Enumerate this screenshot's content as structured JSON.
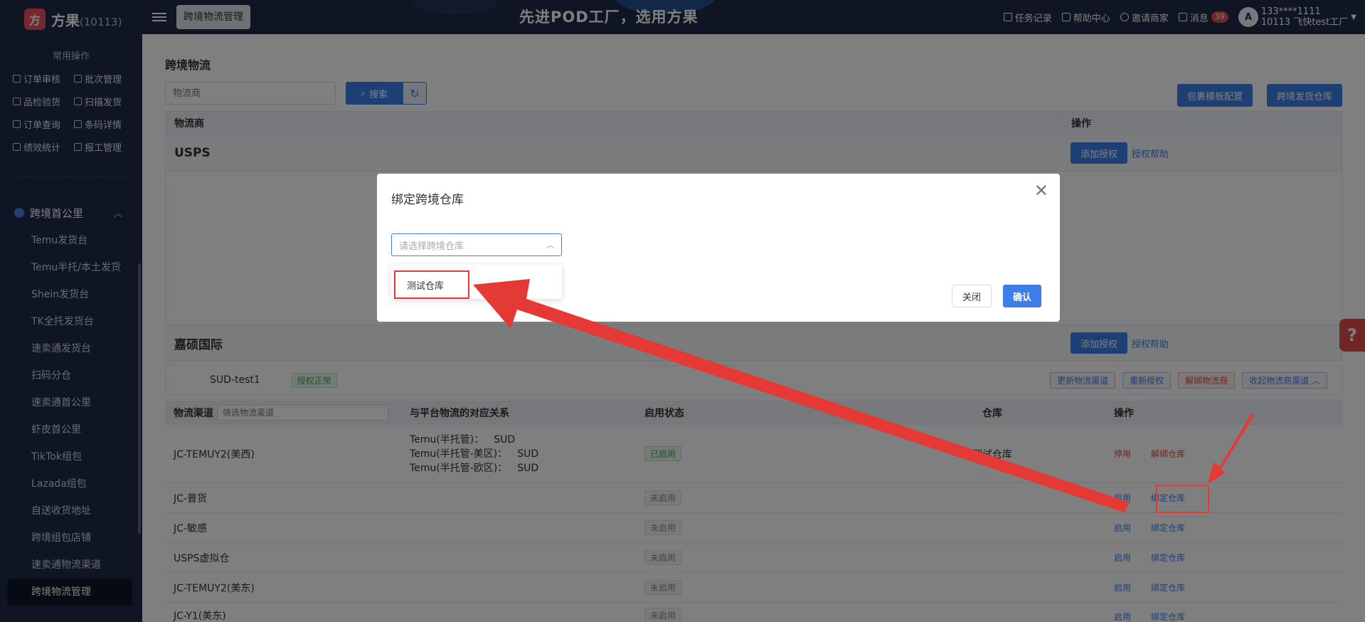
{
  "sidebar": {
    "logo_text": "方果",
    "logo_sub": "(10113)",
    "common_title": "常用操作",
    "quick": [
      {
        "label": "订单审核",
        "icon": "checkbox-icon"
      },
      {
        "label": "批次管理",
        "icon": "document-icon"
      },
      {
        "label": "品检验货",
        "icon": "clipboard-icon"
      },
      {
        "label": "扫描发货",
        "icon": "scan-icon"
      },
      {
        "label": "订单查询",
        "icon": "search-doc-icon"
      },
      {
        "label": "条码详情",
        "icon": "barcode-icon"
      },
      {
        "label": "绩效统计",
        "icon": "chart-icon"
      },
      {
        "label": "报工管理",
        "icon": "report-icon"
      }
    ],
    "group_title": "跨境首公里",
    "menu": [
      "Temu发货台",
      "Temu半托/本土发货",
      "Shein发货台",
      "TK全托发货台",
      "速卖通发货台",
      "扫码分仓",
      "速卖通首公里",
      "虾皮首公里",
      "TikTok组包",
      "Lazada组包",
      "自送收货地址",
      "跨境组包店铺",
      "速卖通物流渠道",
      "跨境物流管理"
    ]
  },
  "topbar": {
    "tab_label": "跨境物流管理",
    "slogan": "先进POD工厂，选用方果",
    "task_label": "任务记录",
    "help_label": "帮助中心",
    "invite_label": "邀请商家",
    "message_label": "消息",
    "message_count": "39",
    "avatar_letter": "A",
    "user_phone": "133****1111",
    "user_factory": "10113 飞快test工厂"
  },
  "main": {
    "title": "跨境物流",
    "search_placeholder": "物流商",
    "search_label": "搜索",
    "refresh_glyph": "↻",
    "btn_template": "包裹模板配置",
    "btn_warehouse": "跨境发货仓库",
    "col_provider": "物流商",
    "col_ops": "操作",
    "providers": [
      {
        "name": "USPS",
        "add_label": "添加授权",
        "help_label": "授权帮助"
      },
      {
        "name": "嘉硕国际",
        "add_label": "添加授权",
        "help_label": "授权帮助"
      }
    ],
    "sub_account": {
      "name": "SUD-test1",
      "status": "授权正常",
      "ops": [
        "更新物流渠道",
        "重新授权",
        "解绑物流商",
        "收起物流商渠道"
      ]
    },
    "channel_head": {
      "channel": "物流渠道",
      "filter_placeholder": "筛选物流渠道",
      "mapping": "与平台物流的对应关系",
      "status": "启用状态",
      "warehouse": "仓库",
      "ops": "操作"
    },
    "channels": [
      {
        "name": "JC-TEMUY2(美西)",
        "mapping": [
          [
            "Temu(半托管)：",
            "SUD"
          ],
          [
            "Temu(半托管-美区)：",
            "SUD"
          ],
          [
            "Temu(半托管-欧区)：",
            "SUD"
          ]
        ],
        "status": "已启用",
        "warehouse": "测试仓库",
        "op1": "停用",
        "op2": "解绑仓库"
      },
      {
        "name": "JC-普货",
        "status": "未启用",
        "warehouse": "",
        "op1": "启用",
        "op2": "绑定仓库"
      },
      {
        "name": "JC-敏感",
        "status": "未启用",
        "warehouse": "",
        "op1": "启用",
        "op2": "绑定仓库"
      },
      {
        "name": "USPS虚拟仓",
        "status": "未启用",
        "warehouse": "",
        "op1": "启用",
        "op2": "绑定仓库"
      },
      {
        "name": "JC-TEMUY2(美东)",
        "status": "未启用",
        "warehouse": "",
        "op1": "启用",
        "op2": "绑定仓库"
      },
      {
        "name": "JC-Y1(美东)",
        "status": "未启用",
        "warehouse": "",
        "op1": "启用",
        "op2": "绑定仓库"
      }
    ],
    "help_float": "?"
  },
  "modal": {
    "title": "绑定跨境仓库",
    "close_glyph": "✕",
    "select_placeholder": "请选择跨境仓库",
    "option": "测试仓库",
    "btn_close": "关闭",
    "btn_confirm": "确认"
  },
  "colors": {
    "sidebar_bg": "#1f2a44",
    "primary": "#3d7ee8",
    "annotation_red": "#e53935",
    "success": "#34a853"
  }
}
